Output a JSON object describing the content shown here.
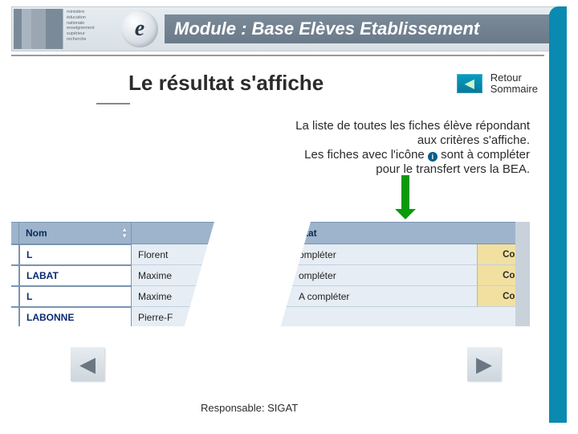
{
  "header": {
    "module_title": "Module : Base Elèves Etablissement",
    "ministry_lines": [
      "ministère",
      "éducation",
      "nationale",
      "enseignement",
      "supérieur",
      "recherche"
    ],
    "badge_letter": "e"
  },
  "title": "Le résultat s'affiche",
  "retour": {
    "label": "Retour",
    "sub": "Sommaire"
  },
  "desc": {
    "line1": "La liste de toutes les fiches élève répondant",
    "line2": "aux critères s'affiche.",
    "line3_a": "Les fiches avec l'icône ",
    "line3_b": " sont à compléter",
    "line4": "pour le transfert vers la BEA."
  },
  "table": {
    "headers": {
      "nom": "Nom",
      "prenom": "",
      "etat": "Etat"
    },
    "action": "Compléter",
    "etat_prefix": "A compléter",
    "rows": [
      {
        "nom": "L",
        "prenom": "Florent",
        "etat": "ompléter"
      },
      {
        "nom": "LABAT",
        "prenom": "Maxime",
        "etat": "ompléter"
      },
      {
        "nom": "L",
        "prenom": "Maxime",
        "etat": "A compléter"
      },
      {
        "nom": "LABONNE",
        "prenom": "Pierre-F",
        "etat": ""
      }
    ]
  },
  "footer": {
    "responsable": "Responsable: SIGAT"
  }
}
